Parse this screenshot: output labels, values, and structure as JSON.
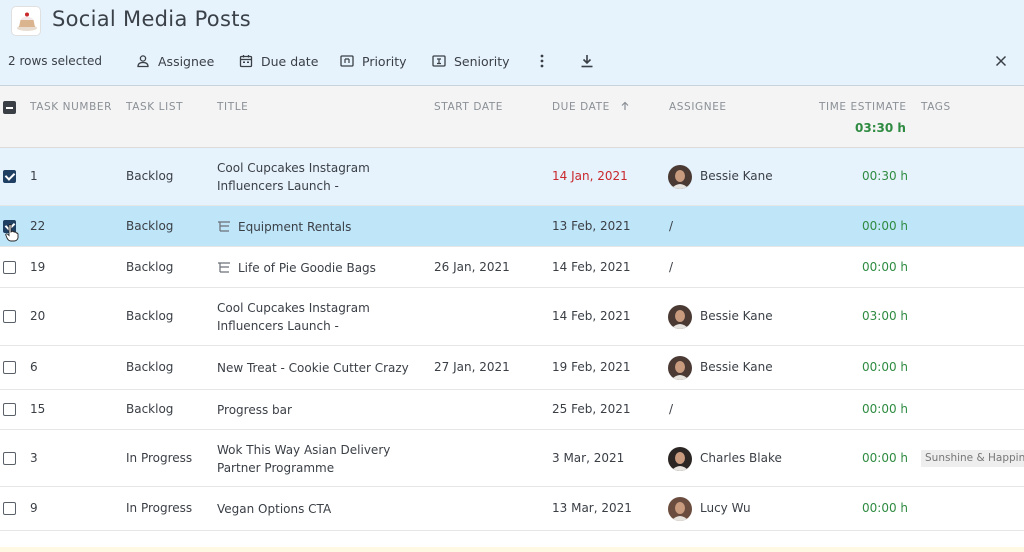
{
  "page": {
    "title": "Social Media Posts"
  },
  "toolbar": {
    "selected_text": "2 rows selected",
    "assignee_label": "Assignee",
    "due_date_label": "Due date",
    "priority_label": "Priority",
    "seniority_label": "Seniority"
  },
  "columns": {
    "task_number": "TASK NUMBER",
    "task_list": "TASK LIST",
    "title": "TITLE",
    "start_date": "START DATE",
    "due_date": "DUE DATE",
    "assignee": "ASSIGNEE",
    "time_estimate": "TIME ESTIMATE",
    "tags": "TAGS",
    "time_estimate_total": "03:30 h"
  },
  "rows": [
    {
      "number": "1",
      "list": "Backlog",
      "title": "Cool Cupcakes Instagram Influencers Launch -",
      "start": "",
      "due": "14 Jan, 2021",
      "assignee": "Bessie Kane",
      "estimate": "00:30 h",
      "tag": "",
      "checked": true,
      "overdue": true,
      "subtask": false
    },
    {
      "number": "22",
      "list": "Backlog",
      "title": "Equipment Rentals",
      "start": "",
      "due": "13 Feb, 2021",
      "assignee": "/",
      "estimate": "00:00 h",
      "tag": "",
      "checked": true,
      "overdue": false,
      "subtask": true
    },
    {
      "number": "19",
      "list": "Backlog",
      "title": "Life of Pie Goodie Bags",
      "start": "26 Jan, 2021",
      "due": "14 Feb, 2021",
      "assignee": "/",
      "estimate": "00:00 h",
      "tag": "",
      "checked": false,
      "overdue": false,
      "subtask": true
    },
    {
      "number": "20",
      "list": "Backlog",
      "title": "Cool Cupcakes Instagram Influencers Launch -",
      "start": "",
      "due": "14 Feb, 2021",
      "assignee": "Bessie Kane",
      "estimate": "03:00 h",
      "tag": "",
      "checked": false,
      "overdue": false,
      "subtask": false
    },
    {
      "number": "6",
      "list": "Backlog",
      "title": "New Treat - Cookie Cutter Crazy",
      "start": "27 Jan, 2021",
      "due": "19 Feb, 2021",
      "assignee": "Bessie Kane",
      "estimate": "00:00 h",
      "tag": "",
      "checked": false,
      "overdue": false,
      "subtask": false
    },
    {
      "number": "15",
      "list": "Backlog",
      "title": "Progress bar",
      "start": "",
      "due": "25 Feb, 2021",
      "assignee": "/",
      "estimate": "00:00 h",
      "tag": "",
      "checked": false,
      "overdue": false,
      "subtask": false
    },
    {
      "number": "3",
      "list": "In Progress",
      "title": "Wok This Way Asian Delivery Partner Programme",
      "start": "",
      "due": "3 Mar, 2021",
      "assignee": "Charles Blake",
      "estimate": "00:00 h",
      "tag": "Sunshine & Happine",
      "checked": false,
      "overdue": false,
      "subtask": false
    },
    {
      "number": "9",
      "list": "In Progress",
      "title": "Vegan Options CTA",
      "start": "",
      "due": "13 Mar, 2021",
      "assignee": "Lucy Wu",
      "estimate": "00:00 h",
      "tag": "",
      "checked": false,
      "overdue": false,
      "subtask": false
    }
  ],
  "colors": {
    "accent_green": "#2e8b41",
    "overdue_red": "#c9282d",
    "selected_row": "#e7f3fc",
    "hover_row": "#bfe5f8"
  },
  "icons": {
    "assignee": "person-icon",
    "due_date": "calendar-icon",
    "priority": "priority-icon",
    "seniority": "seniority-icon",
    "more": "kebab-menu-icon",
    "download": "download-icon",
    "close": "close-icon",
    "sort": "arrow-up-icon"
  }
}
